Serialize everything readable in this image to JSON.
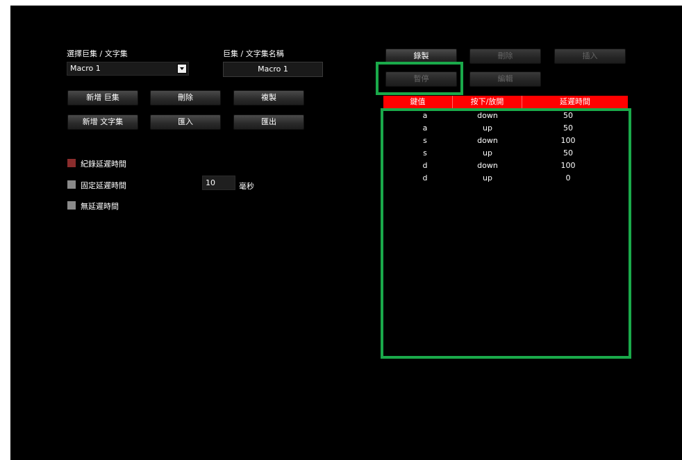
{
  "macro": {
    "select_label": "選擇巨集 / 文字集",
    "selected": "Macro 1",
    "name_label": "巨集 / 文字集名稱",
    "name_value": "Macro 1"
  },
  "buttons": {
    "new_macro": "新增 巨集",
    "delete": "刪除",
    "copy": "複製",
    "new_text": "新增 文字集",
    "import": "匯入",
    "export": "匯出"
  },
  "delay": {
    "record": "紀錄延遲時間",
    "fixed": "固定延遲時間",
    "none": "無延遲時間",
    "fixed_value": "10",
    "unit": "毫秒"
  },
  "recorder": {
    "record": "錄製",
    "delete": "刪除",
    "insert": "插入",
    "pause": "暫停",
    "edit": "編輯"
  },
  "table": {
    "columns": [
      "鍵值",
      "按下/放開",
      "延遲時間"
    ],
    "rows": [
      [
        "a",
        "down",
        "50"
      ],
      [
        "a",
        "up",
        "50"
      ],
      [
        "s",
        "down",
        "100"
      ],
      [
        "s",
        "up",
        "50"
      ],
      [
        "d",
        "down",
        "100"
      ],
      [
        "d",
        "up",
        "0"
      ]
    ]
  },
  "colors": {
    "header_red": "#ff0000",
    "record_checkbox": "#8a2c2c",
    "highlight_green": "#1aa94a"
  }
}
